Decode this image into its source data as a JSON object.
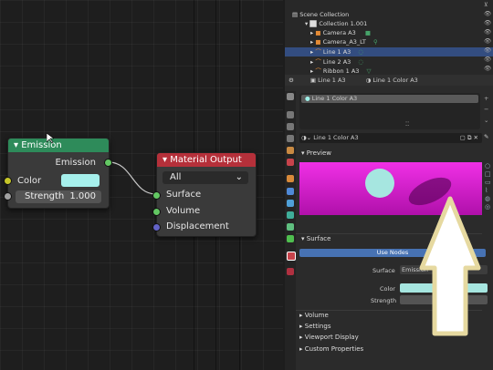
{
  "node_editor": {
    "emission_node": {
      "title": "Emission",
      "output_label": "Emission",
      "color_label": "Color",
      "strength_label": "Strength",
      "strength_value": "1.000",
      "color_swatch": "#a6f0ec",
      "header_color": "#2e8b5a"
    },
    "output_node": {
      "title": "Material Output",
      "target_value": "All",
      "inputs": [
        "Surface",
        "Volume",
        "Displacement"
      ],
      "header_color": "#b5303a"
    }
  },
  "outliner": {
    "header": "Scene Collection",
    "rows": [
      {
        "label": "Collection 1.001"
      },
      {
        "label": "Camera A3"
      },
      {
        "label": "Camera_A3_LT"
      },
      {
        "label": "Line 1 A3",
        "selected": true
      },
      {
        "label": "Line 2 A3"
      },
      {
        "label": "Ribbon 1 A3"
      }
    ]
  },
  "properties": {
    "header_object": "Line 1 A3",
    "header_material": "Line 1 Color A3",
    "material_slot": "Line 1 Color A3",
    "material_name": "Line 1 Color A3",
    "preview_label": "Preview",
    "surface_label": "Surface",
    "use_nodes_label": "Use Nodes",
    "surface_field_label": "Surface",
    "surface_field_value": "Emission",
    "color_label": "Color",
    "strength_label": "Strength",
    "collapsed_panels": [
      "Volume",
      "Settings",
      "Viewport Display",
      "Custom Properties"
    ]
  },
  "colors": {
    "accent": "#4772b3",
    "preview_bg": "#e020d8",
    "sphere": "#a6e6e0",
    "arrow_fill": "#ffffff",
    "arrow_stroke": "#e6d9a0"
  }
}
